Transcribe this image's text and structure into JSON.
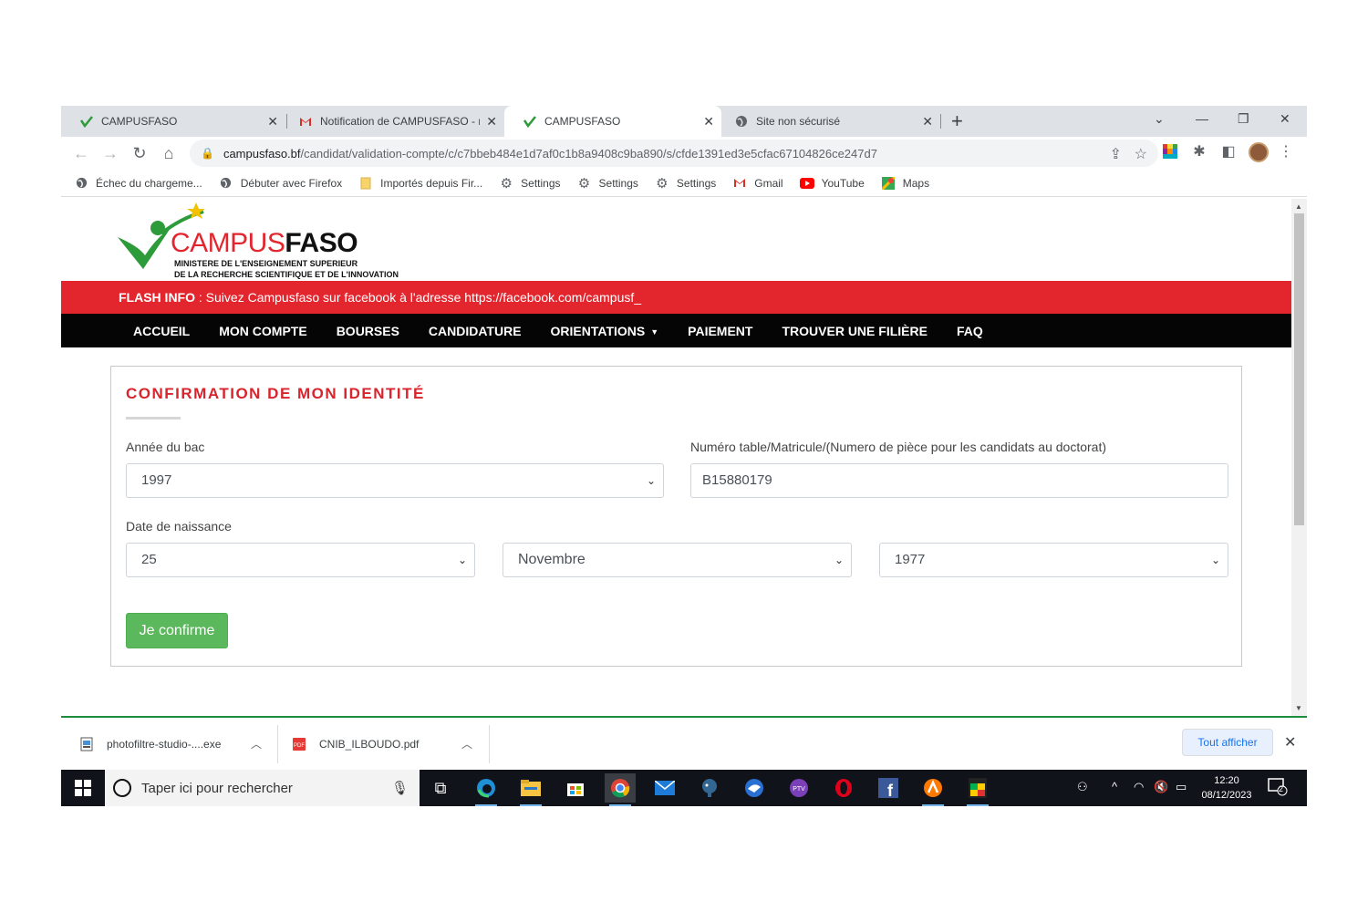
{
  "browser": {
    "tabs": [
      {
        "title": "CAMPUSFASO",
        "icon": "campusfaso-check-icon",
        "active": false
      },
      {
        "title": "Notification de CAMPUSFASO - r",
        "icon": "gmail-icon",
        "active": false
      },
      {
        "title": "CAMPUSFASO",
        "icon": "campusfaso-check-icon",
        "active": true
      },
      {
        "title": "Site non sécurisé",
        "icon": "globe-icon",
        "active": false
      }
    ],
    "new_tab": "+",
    "url_domain": "campusfaso.bf",
    "url_path": "/candidat/validation-compte/c/c7bbeb484e1d7af0c1b8a9408c9ba890/s/cfde1391ed3e5cfac67104826ce247d7",
    "bookmarks": [
      {
        "label": "Échec du chargeme...",
        "icon": "globe-icon"
      },
      {
        "label": "Débuter avec Firefox",
        "icon": "globe-icon"
      },
      {
        "label": "Importés depuis Fir...",
        "icon": "folder-icon"
      },
      {
        "label": "Settings",
        "icon": "gear-icon"
      },
      {
        "label": "Settings",
        "icon": "gear-icon"
      },
      {
        "label": "Settings",
        "icon": "gear-icon"
      },
      {
        "label": "Gmail",
        "icon": "gmail-icon"
      },
      {
        "label": "YouTube",
        "icon": "youtube-icon"
      },
      {
        "label": "Maps",
        "icon": "maps-icon"
      }
    ]
  },
  "site": {
    "logo_brand_part1": "CAMPUS",
    "logo_brand_part2": "FASO",
    "logo_sub1": "MINISTERE DE L'ENSEIGNEMENT SUPERIEUR",
    "logo_sub2": "DE LA RECHERCHE SCIENTIFIQUE ET DE L'INNOVATION",
    "flash_label": "FLASH INFO",
    "flash_text": " : Suivez Campusfaso sur facebook à l'adresse https://facebook.com/campusf_",
    "nav": [
      "ACCUEIL",
      "MON COMPTE",
      "BOURSES",
      "CANDIDATURE",
      "ORIENTATIONS",
      "PAIEMENT",
      "TROUVER UNE FILIÈRE",
      "FAQ"
    ]
  },
  "form": {
    "title": "CONFIRMATION DE MON IDENTITÉ",
    "bac_year_label": "Année du bac",
    "bac_year_value": "1997",
    "matricule_label": "Numéro table/Matricule/(Numero de pièce pour les candidats au doctorat)",
    "matricule_value": "B15880179",
    "birth_label": "Date de naissance",
    "birth_day": "25",
    "birth_month": "Novembre",
    "birth_year": "1977",
    "submit_label": "Je confirme"
  },
  "downloads": {
    "items": [
      {
        "name": "photofiltre-studio-....exe",
        "icon": "exe-file-icon"
      },
      {
        "name": "CNIB_ILBOUDO.pdf",
        "icon": "pdf-file-icon"
      }
    ],
    "show_all": "Tout afficher"
  },
  "taskbar": {
    "search_placeholder": "Taper ici pour rechercher",
    "time": "12:20",
    "date": "08/12/2023",
    "notification_count": "2"
  },
  "colors": {
    "brand_red": "#e3262e",
    "nav_black": "#050505",
    "confirm_green": "#5cb85c",
    "title_red": "#d8242c"
  }
}
